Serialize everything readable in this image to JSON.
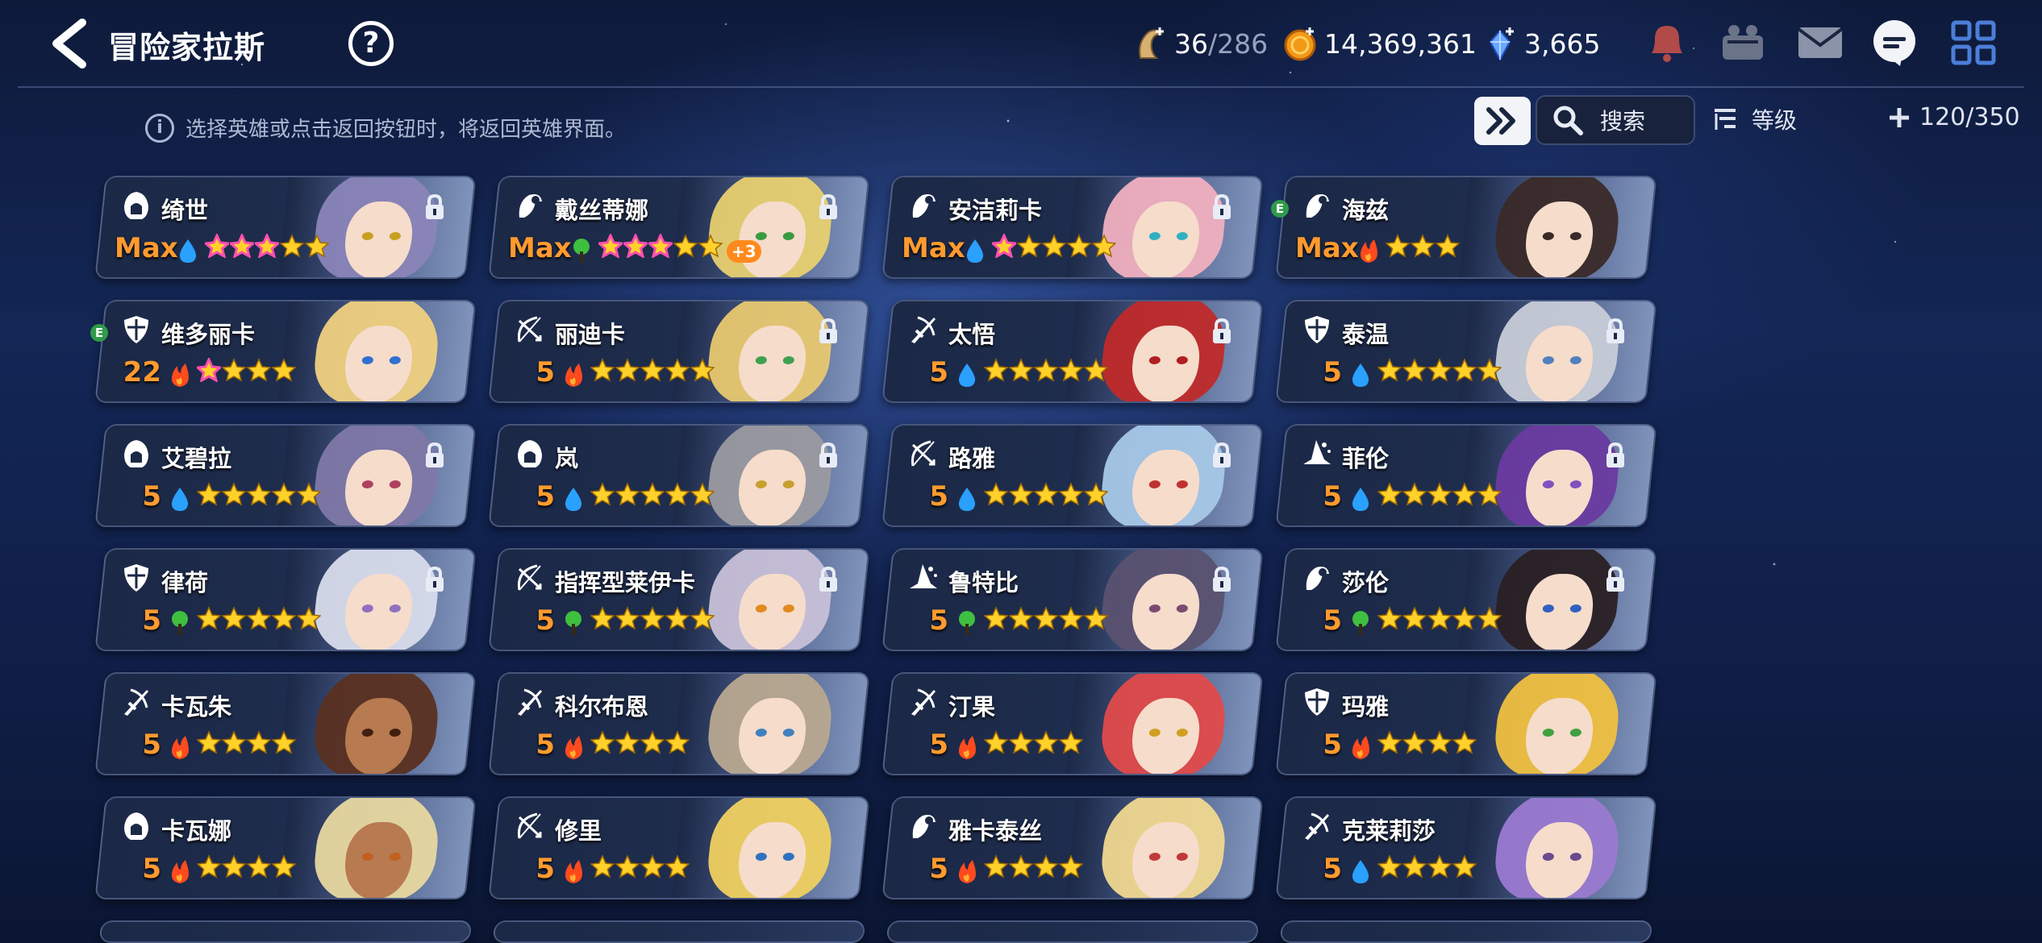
{
  "header": {
    "title": "冒险家拉斯",
    "help": "?",
    "stamina": {
      "current": "36",
      "max": "/286"
    },
    "gold": "14,369,361",
    "gems": "3,665"
  },
  "subbar": {
    "hint": "选择英雄或点击返回按钮时，将返回英雄界面。",
    "info_mark": "i",
    "search_placeholder": "搜索",
    "sort_label": "等级",
    "hero_count": "120/350"
  },
  "colors": {
    "level": "#ff9a2e",
    "water": "#2aa0ff",
    "fire": "#ff4a1e",
    "earth": "#3fbf3f",
    "star": "#ffd12a",
    "star_pink": "#ff4fb0"
  },
  "heroes": [
    {
      "name": "绮世",
      "level": "Max",
      "element": "water",
      "stars": 5,
      "pink": 3,
      "cls": "hood",
      "locked": true,
      "hair": "#8a85b8",
      "eye": "#c8a020"
    },
    {
      "name": "戴丝蒂娜",
      "level": "Max",
      "element": "earth",
      "stars": 5,
      "pink": 3,
      "plus": "+3",
      "cls": "mage",
      "locked": true,
      "hair": "#e8d070",
      "eye": "#3a9a40"
    },
    {
      "name": "安洁莉卡",
      "level": "Max",
      "element": "water",
      "stars": 5,
      "pink": 1,
      "cls": "mage",
      "locked": true,
      "hair": "#f0b0c0",
      "eye": "#30b0c0"
    },
    {
      "name": "海兹",
      "level": "Max",
      "element": "fire",
      "stars": 3,
      "pink": 0,
      "cls": "mage",
      "ebadge": "E",
      "locked": false,
      "hair": "#3a2a28",
      "eye": "#3a2a28"
    },
    {
      "name": "维多丽卡",
      "level": "22",
      "element": "fire",
      "stars": 4,
      "pink": 1,
      "cls": "shield",
      "ebadge": "E",
      "locked": false,
      "hair": "#f0d080",
      "eye": "#3070d0"
    },
    {
      "name": "丽迪卡",
      "level": "5",
      "element": "fire",
      "stars": 5,
      "pink": 0,
      "cls": "bow",
      "locked": true,
      "hair": "#e8c870",
      "eye": "#40a050"
    },
    {
      "name": "太悟",
      "level": "5",
      "element": "water",
      "stars": 5,
      "pink": 0,
      "cls": "sword",
      "locked": true,
      "hair": "#c02a2a",
      "eye": "#b02020"
    },
    {
      "name": "泰温",
      "level": "5",
      "element": "water",
      "stars": 5,
      "pink": 0,
      "cls": "shield",
      "locked": true,
      "hair": "#c8ccd8",
      "eye": "#5080c0"
    },
    {
      "name": "艾碧拉",
      "level": "5",
      "element": "water",
      "stars": 5,
      "pink": 0,
      "cls": "hood",
      "locked": true,
      "hair": "#8078a8",
      "eye": "#b04060"
    },
    {
      "name": "岚",
      "level": "5",
      "element": "water",
      "stars": 5,
      "pink": 0,
      "cls": "hood",
      "locked": true,
      "hair": "#9a9aa0",
      "eye": "#c8a030"
    },
    {
      "name": "路雅",
      "level": "5",
      "element": "water",
      "stars": 5,
      "pink": 0,
      "cls": "bow",
      "locked": true,
      "hair": "#a8c8e8",
      "eye": "#c03030"
    },
    {
      "name": "菲伦",
      "level": "5",
      "element": "water",
      "stars": 5,
      "pink": 0,
      "cls": "witch",
      "locked": true,
      "hair": "#6a3aa0",
      "eye": "#8050c0"
    },
    {
      "name": "律荷",
      "level": "5",
      "element": "earth",
      "stars": 5,
      "pink": 0,
      "cls": "shield",
      "locked": true,
      "hair": "#d8dcec",
      "eye": "#9070c0"
    },
    {
      "name": "指挥型莱伊卡",
      "level": "5",
      "element": "earth",
      "stars": 5,
      "pink": 0,
      "cls": "bow",
      "locked": true,
      "hair": "#c8c0d8",
      "eye": "#e08a20"
    },
    {
      "name": "鲁特比",
      "level": "5",
      "element": "earth",
      "stars": 5,
      "pink": 0,
      "cls": "witch",
      "locked": true,
      "hair": "#5a5270",
      "eye": "#7a4a70"
    },
    {
      "name": "莎伦",
      "level": "5",
      "element": "earth",
      "stars": 5,
      "pink": 0,
      "cls": "mage",
      "locked": true,
      "hair": "#2a2024",
      "eye": "#3060c0"
    },
    {
      "name": "卡瓦朱",
      "level": "5",
      "element": "fire",
      "stars": 4,
      "pink": 0,
      "cls": "sword",
      "locked": false,
      "hair": "#5a3020",
      "eye": "#402010",
      "dark": true
    },
    {
      "name": "科尔布恩",
      "level": "5",
      "element": "fire",
      "stars": 4,
      "pink": 0,
      "cls": "sword",
      "locked": false,
      "hair": "#b8a890",
      "eye": "#4080c0"
    },
    {
      "name": "汀果",
      "level": "5",
      "element": "fire",
      "stars": 4,
      "pink": 0,
      "cls": "sword",
      "locked": false,
      "hair": "#e04a4a",
      "eye": "#d0a020"
    },
    {
      "name": "玛雅",
      "level": "5",
      "element": "fire",
      "stars": 4,
      "pink": 0,
      "cls": "shield",
      "locked": false,
      "hair": "#f0c040",
      "eye": "#40a040"
    },
    {
      "name": "卡瓦娜",
      "level": "5",
      "element": "fire",
      "stars": 4,
      "pink": 0,
      "cls": "hood",
      "locked": false,
      "hair": "#e8d8a0",
      "eye": "#c06020",
      "dark": true
    },
    {
      "name": "修里",
      "level": "5",
      "element": "fire",
      "stars": 4,
      "pink": 0,
      "cls": "bow",
      "locked": false,
      "hair": "#f0d060",
      "eye": "#3070c0"
    },
    {
      "name": "雅卡泰丝",
      "level": "5",
      "element": "fire",
      "stars": 4,
      "pink": 0,
      "cls": "mage",
      "locked": false,
      "hair": "#f0d890",
      "eye": "#c03a3a"
    },
    {
      "name": "克莱莉莎",
      "level": "5",
      "element": "water",
      "stars": 4,
      "pink": 0,
      "cls": "sword",
      "locked": false,
      "hair": "#9a7ad0",
      "eye": "#6a4a90"
    }
  ]
}
